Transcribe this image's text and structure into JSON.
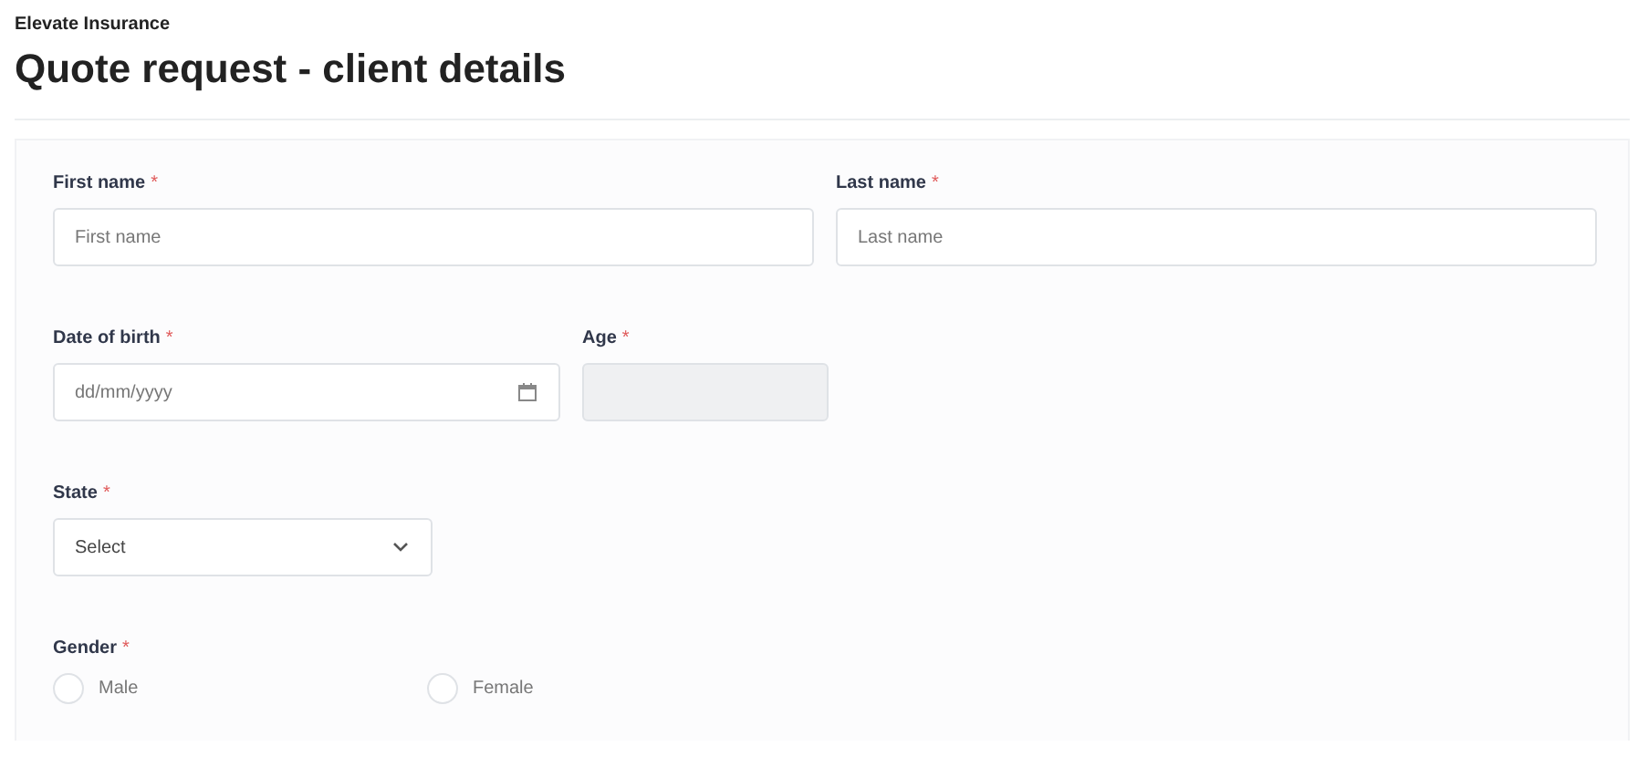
{
  "brand": "Elevate Insurance",
  "title": "Quote request - client details",
  "rows": [
    {
      "fields": [
        {
          "kind": "text",
          "label": "First name",
          "required_mark": "*",
          "placeholder": "First name",
          "disabled": false
        },
        {
          "kind": "text",
          "label": "Last name",
          "required_mark": "*",
          "placeholder": "Last name",
          "disabled": false
        }
      ]
    },
    {
      "fields": [
        {
          "kind": "date",
          "label": "Date of birth",
          "required_mark": "*",
          "placeholder": "dd/mm/yyyy",
          "disabled": false
        },
        {
          "kind": "text",
          "label": "Age",
          "required_mark": "*",
          "disabled": true
        }
      ]
    },
    {
      "fields": [
        {
          "kind": "select",
          "label": "State",
          "required_mark": "*",
          "value": "Select",
          "disabled": false
        }
      ]
    },
    {
      "fields": [
        {
          "kind": "radio",
          "label": "Gender",
          "required_mark": "*",
          "options": [
            {
              "label": "Male",
              "selected": false
            },
            {
              "label": "Female",
              "selected": false
            }
          ]
        }
      ]
    }
  ]
}
